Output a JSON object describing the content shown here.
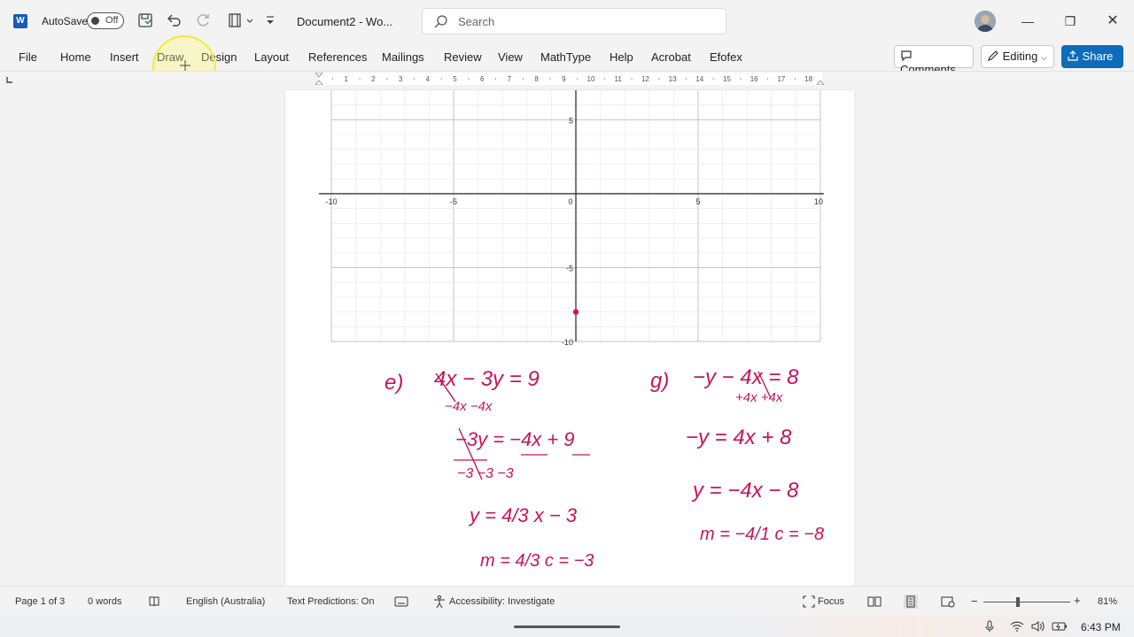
{
  "titlebar": {
    "app_logo": "W",
    "autosave_label": "AutoSave",
    "autosave_state": "Off",
    "document_title": "Document2 - Wo...",
    "search_placeholder": "Search"
  },
  "menu": {
    "items": [
      "File",
      "Home",
      "Insert",
      "Draw",
      "Design",
      "Layout",
      "References",
      "Mailings",
      "Review",
      "View",
      "MathType",
      "Help",
      "Acrobat",
      "Efofex"
    ],
    "comments_label": "Comments",
    "editing_label": "Editing",
    "share_label": "Share"
  },
  "ruler": {
    "labels": [
      "1",
      "2",
      "3",
      "4",
      "5",
      "6",
      "7",
      "8",
      "9",
      "10",
      "11",
      "12",
      "13",
      "14",
      "15",
      "16",
      "17",
      "18"
    ]
  },
  "graph": {
    "x_ticks": [
      "-10",
      "-5",
      "0",
      "5",
      "10"
    ],
    "y_ticks": [
      "5",
      "-5",
      "-10"
    ],
    "point": {
      "x": 0,
      "y": -8
    },
    "point_color": "#d0145a",
    "xlim": [
      -10,
      10
    ],
    "ylim": [
      -10,
      7
    ]
  },
  "handwriting": {
    "color": "#c8145c",
    "e": {
      "label": "e)",
      "line1": "4x − 3y = 9",
      "line1_sub": "−4x        −4x",
      "line2": "−3y = −4x + 9",
      "line2_div": "−3       −3      −3",
      "line3": "y = 4/3 x − 3",
      "line4": "m = 4/3     c = −3"
    },
    "g": {
      "label": "g)",
      "line1": "−y − 4x = 8",
      "line1_sub": "+4x        +4x",
      "line2": "−y = 4x + 8",
      "line3": "y = −4x − 8",
      "line4": "m = −4/1     c = −8"
    }
  },
  "status": {
    "page": "Page 1 of 3",
    "words": "0 words",
    "language": "English (Australia)",
    "text_predictions": "Text Predictions: On",
    "accessibility": "Accessibility: Investigate",
    "focus": "Focus",
    "zoom": "81%"
  },
  "taskbar": {
    "time": "6:43 PM"
  },
  "colors": {
    "accent": "#0f6cbd",
    "word_blue": "#185abd",
    "ink": "#c8145c"
  }
}
